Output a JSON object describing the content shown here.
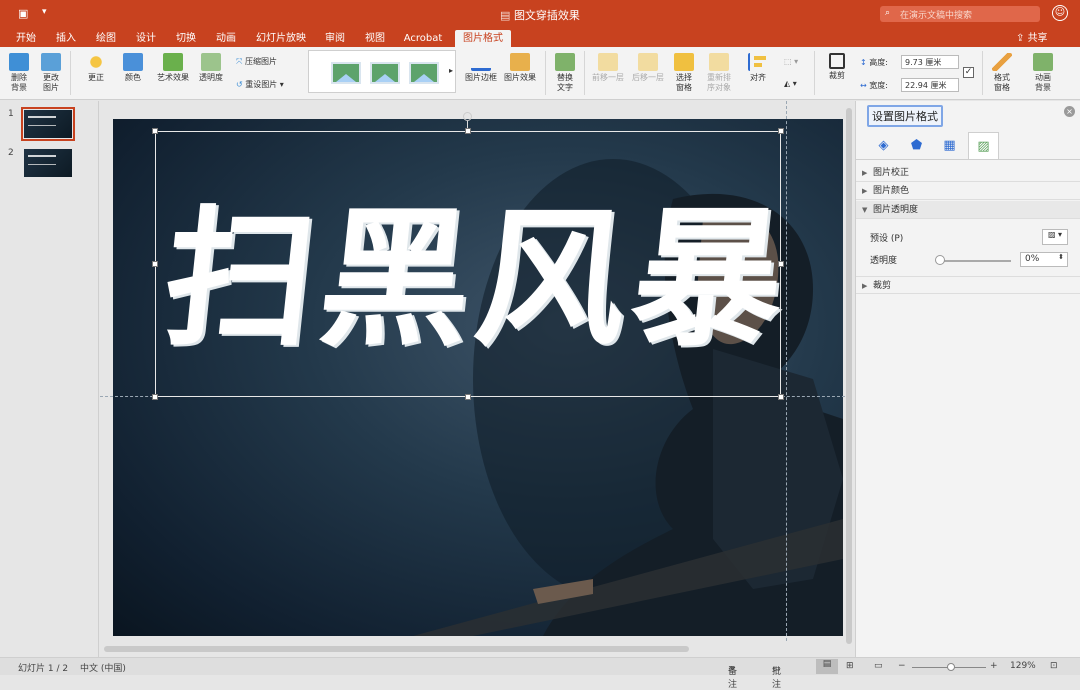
{
  "app": {
    "title": "图文穿插效果",
    "search_placeholder": "在演示文稿中搜索"
  },
  "tabs": [
    "开始",
    "插入",
    "绘图",
    "设计",
    "切换",
    "动画",
    "幻灯片放映",
    "审阅",
    "视图",
    "Acrobat",
    "图片格式"
  ],
  "active_tab": "图片格式",
  "share_label": "共享",
  "ribbon": {
    "remove_bg": "删除\n背景",
    "change_pic": "更改\n图片",
    "corrections": "更正",
    "color": "颜色",
    "artistic": "艺术效果",
    "transparency": "透明度",
    "compress": "压缩图片",
    "reset": "重设图片",
    "border": "图片边框",
    "effects": "图片效果",
    "alt_text": "替换\n文字",
    "bring_forward": "前移一层",
    "send_backward": "后移一层",
    "selection_pane": "选择\n窗格",
    "reorder": "重新排\n序对象",
    "align": "对齐",
    "crop": "裁剪",
    "height_label": "高度:",
    "height_value": "9.73 厘米",
    "width_label": "宽度:",
    "width_value": "22.94 厘米",
    "format_pane": "格式\n窗格",
    "anim_bg": "动画\n背景"
  },
  "slides": [
    {
      "number": "1"
    },
    {
      "number": "2"
    }
  ],
  "slide": {
    "calligraphy": "扫黑风暴"
  },
  "pane": {
    "title": "设置图片格式",
    "sections": {
      "correction": "图片校正",
      "color": "图片颜色",
      "transparency": "图片透明度",
      "crop": "裁剪"
    },
    "preset_label": "预设 (P)",
    "transparency_label": "透明度",
    "transparency_value": "0%",
    "transparency_level": 0
  },
  "status": {
    "slide_count": "幻灯片 1 / 2",
    "language": "中文 (中国)",
    "notes": "备注",
    "comments": "批注",
    "zoom": "129%"
  }
}
